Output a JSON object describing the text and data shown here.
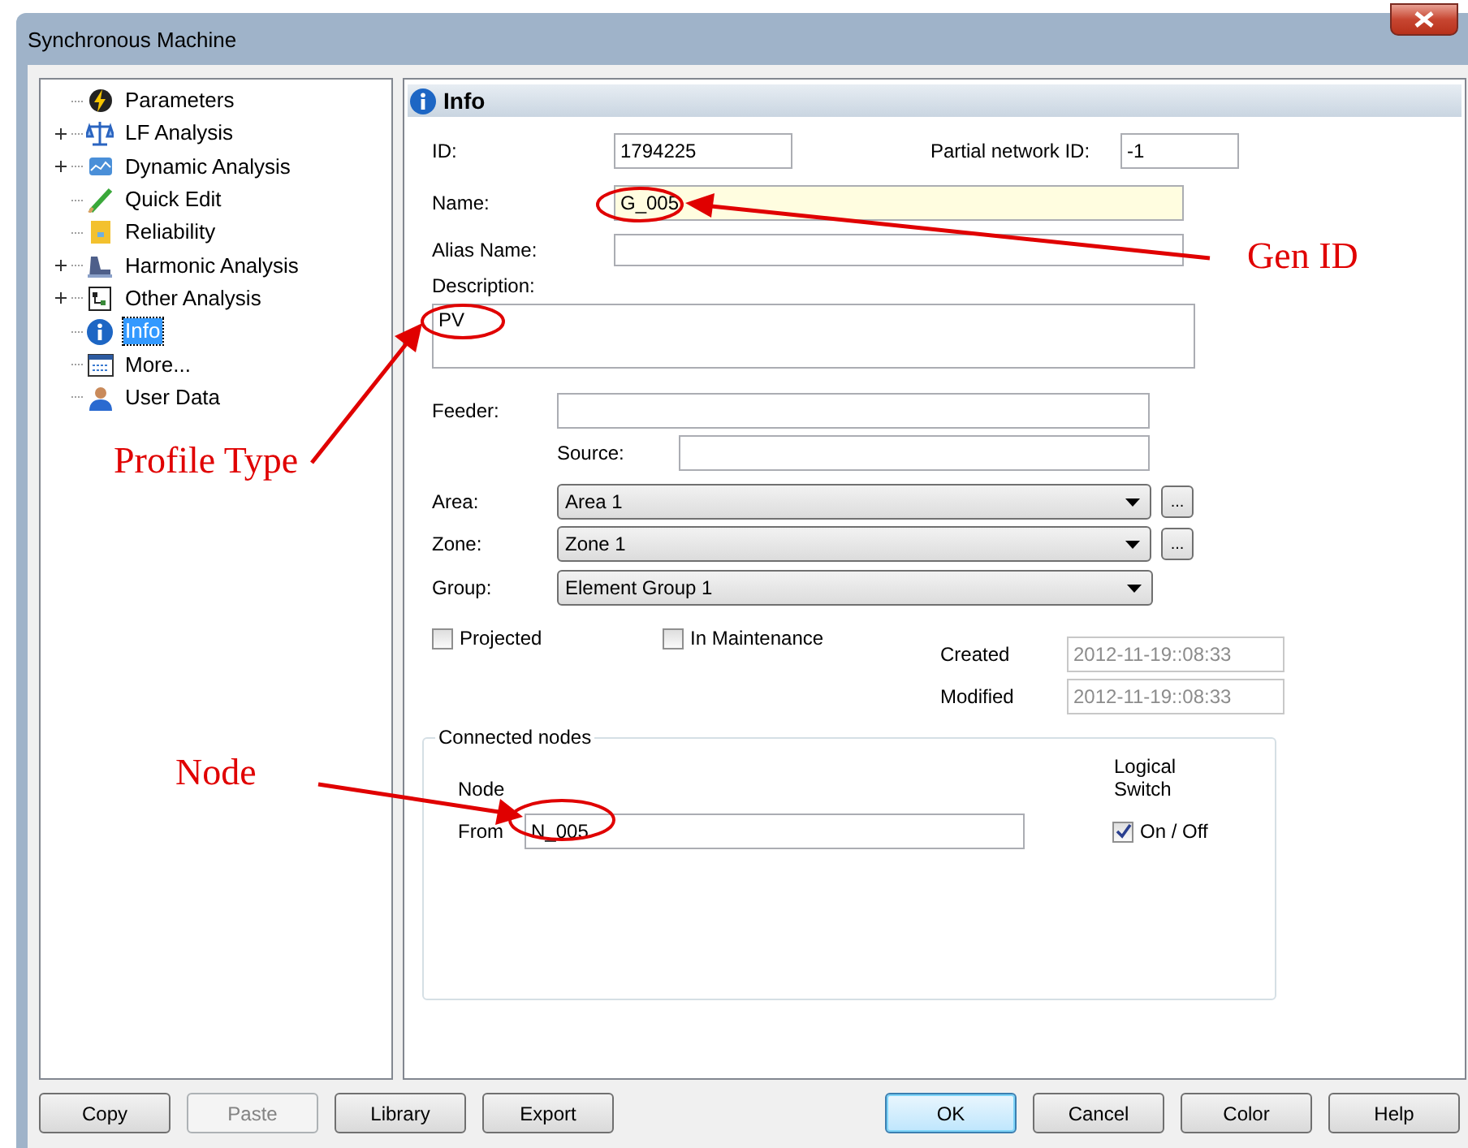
{
  "window": {
    "title": "Synchronous Machine"
  },
  "tree": [
    {
      "label": "Parameters",
      "expandable": false,
      "selected": false
    },
    {
      "label": "LF Analysis",
      "expandable": true,
      "selected": false
    },
    {
      "label": "Dynamic Analysis",
      "expandable": true,
      "selected": false
    },
    {
      "label": "Quick Edit",
      "expandable": false,
      "selected": false
    },
    {
      "label": "Reliability",
      "expandable": false,
      "selected": false
    },
    {
      "label": "Harmonic Analysis",
      "expandable": true,
      "selected": false
    },
    {
      "label": "Other Analysis",
      "expandable": true,
      "selected": false
    },
    {
      "label": "Info",
      "expandable": false,
      "selected": true
    },
    {
      "label": "More...",
      "expandable": false,
      "selected": false
    },
    {
      "label": "User Data",
      "expandable": false,
      "selected": false
    }
  ],
  "panel": {
    "title": "Info",
    "id": {
      "label": "ID:",
      "value": "1794225"
    },
    "partial_network_id": {
      "label": "Partial network ID:",
      "value": "-1"
    },
    "name": {
      "label": "Name:",
      "value": "G_005",
      "highlighted": true
    },
    "alias_name": {
      "label": "Alias Name:"
    },
    "description": {
      "label": "Description:",
      "value": "PV"
    },
    "feeder": {
      "label": "Feeder:"
    },
    "source": {
      "label": "Source:"
    },
    "area": {
      "label": "Area:",
      "value": "Area 1",
      "browse": "..."
    },
    "zone": {
      "label": "Zone:",
      "value": "Zone 1",
      "browse": "..."
    },
    "group": {
      "label": "Group:",
      "value": "Element Group 1"
    },
    "checkboxes": [
      {
        "label": "Projected",
        "checked": false
      },
      {
        "label": "In Maintenance",
        "checked": false
      }
    ],
    "created": {
      "label": "Created",
      "value": "2012-11-19::08:33",
      "disabled": true
    },
    "modified": {
      "label": "Modified",
      "value": "2012-11-19::08:33",
      "disabled": true
    },
    "connected_nodes": {
      "title": "Connected nodes",
      "node_header": "Node",
      "switch_header": "Logical Switch",
      "from": {
        "label": "From",
        "value": "N_005"
      },
      "switch": {
        "label": "On / Off",
        "checked": true
      }
    }
  },
  "buttons": [
    {
      "label": "Copy",
      "disabled": false,
      "default": false
    },
    {
      "label": "Paste",
      "disabled": true,
      "default": false
    },
    {
      "label": "Library",
      "disabled": false,
      "default": false
    },
    {
      "label": "Export",
      "disabled": false,
      "default": false
    },
    {
      "label": "OK",
      "disabled": false,
      "default": true
    },
    {
      "label": "Cancel",
      "disabled": false,
      "default": false
    },
    {
      "label": "Color",
      "disabled": false,
      "default": false
    },
    {
      "label": "Help",
      "disabled": false,
      "default": false
    }
  ],
  "annotations": [
    {
      "text": "Gen ID"
    },
    {
      "text": "Profile Type"
    },
    {
      "text": "Node"
    }
  ]
}
